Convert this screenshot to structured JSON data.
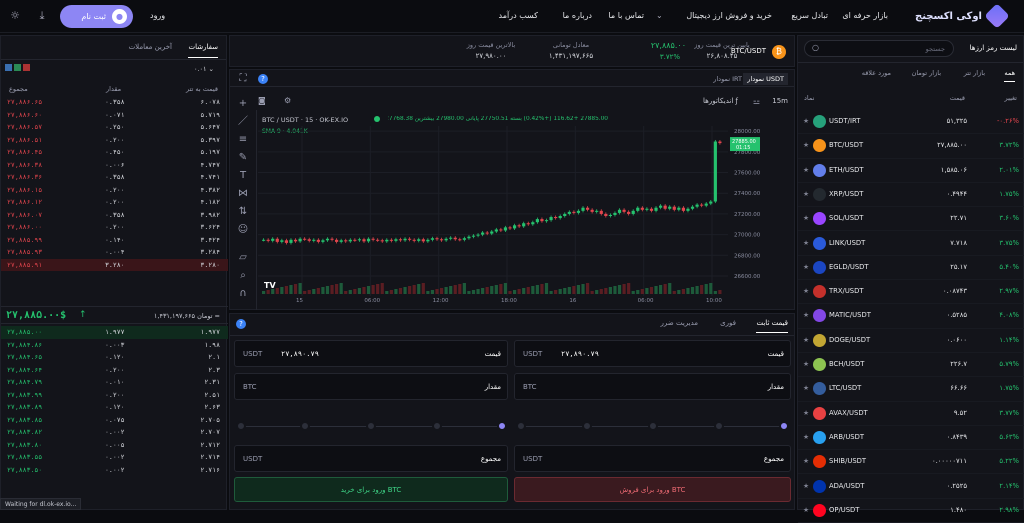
{
  "nav": {
    "brand": "اوکی اکسچنج",
    "links": [
      "بازار حرفه ای",
      "تبادل سریع",
      "خرید و فروش ارز دیجیتال",
      "تماس با ما",
      "درباره ما",
      "کسب درآمد"
    ],
    "signup": "ثبت نام",
    "login": "ورود"
  },
  "book": {
    "tabs": [
      "سفارشات",
      "آخرین معاملات"
    ],
    "precision": "۰.۰۱",
    "headers": [
      "قیمت به تتر",
      "مقدار",
      "مجموع"
    ],
    "asks": [
      [
        "۲۷,۸۸۶.۶۵",
        "۰.۳۵۸",
        "۶.۰۷۸"
      ],
      [
        "۲۷,۸۸۶.۶۰",
        "۰.۰۷۱",
        "۵.۷۱۹"
      ],
      [
        "۲۷,۸۸۶.۵۷",
        "۰.۲۵۰",
        "۵.۶۴۷"
      ],
      [
        "۲۷,۸۸۶.۵۱",
        "۰.۲۰۰",
        "۵.۳۹۷"
      ],
      [
        "۲۷,۸۸۶.۴۵",
        "۰.۴۵۰",
        "۵.۱۹۷"
      ],
      [
        "۲۷,۸۸۶.۳۸",
        "۰.۰۰۶",
        "۴.۷۴۷"
      ],
      [
        "۲۷,۸۸۶.۳۶",
        "۰.۳۵۸",
        "۴.۷۴۱"
      ],
      [
        "۲۷,۸۸۶.۱۵",
        "۰.۲۰۰",
        "۴.۳۸۲"
      ],
      [
        "۲۷,۸۸۶.۱۲",
        "۰.۲۰۰",
        "۴.۱۸۲"
      ],
      [
        "۲۷,۸۸۶.۰۷",
        "۰.۳۵۸",
        "۳.۹۸۲"
      ],
      [
        "۲۷,۸۸۶.۰۰",
        "۰.۲۰۰",
        "۳.۶۲۴"
      ],
      [
        "۲۷,۸۸۵.۹۹",
        "۰.۱۴۰",
        "۳.۴۲۴"
      ],
      [
        "۲۷,۸۸۵.۹۳",
        "۰.۰۰۴",
        "۳.۲۸۴"
      ],
      [
        "۲۷,۸۸۵.۹۱",
        "۳.۲۸۰",
        "۳.۲۸۰"
      ]
    ],
    "last_price": "۲۷,۸۸۵.۰۰$",
    "last_price_irt": "۱,۴۳۱,۱۹۷,۶۶۵ تومان =",
    "bids": [
      [
        "۲۷,۸۸۵.۰۰",
        "۱.۹۷۷",
        "۱.۹۷۷"
      ],
      [
        "۲۷,۸۸۴.۸۶",
        "۰.۰۰۳",
        "۱.۹۸"
      ],
      [
        "۲۷,۸۸۴.۶۵",
        "۰.۱۲۰",
        "۲.۱"
      ],
      [
        "۲۷,۸۸۴.۶۴",
        "۰.۲۰۰",
        "۲.۳"
      ],
      [
        "۲۷,۸۸۴.۷۹",
        "۰.۰۱۰",
        "۲.۳۱"
      ],
      [
        "۲۷,۸۸۳.۹۹",
        "۰.۲۰۰",
        "۲.۵۱"
      ],
      [
        "۲۷,۸۸۳.۸۹",
        "۰.۱۲۰",
        "۲.۶۳"
      ],
      [
        "۲۷,۸۸۳.۸۵",
        "۰.۰۷۵",
        "۲.۷۰۵"
      ],
      [
        "۲۷,۸۸۳.۸۲",
        "۰.۰۰۲",
        "۲.۷۰۷"
      ],
      [
        "۲۷,۸۸۳.۸۰",
        "۰.۰۰۵",
        "۲.۷۱۲"
      ],
      [
        "۲۷,۸۸۳.۵۵",
        "۰.۰۰۲",
        "۲.۷۱۴"
      ],
      [
        "۲۷,۸۸۳.۵۰",
        "۰.۰۰۲",
        "۲.۷۱۶"
      ]
    ]
  },
  "header": {
    "pair": "BTC/USDT",
    "price": "۲۷,۸۸۵.۰۰",
    "change": "۳.۷۲%",
    "stats": [
      {
        "label": "پایین ترین قیمت روز",
        "value": "۲۶,۸۰۸.۴۵"
      },
      {
        "label": "بالاترین قیمت روز",
        "value": "۲۷,۹۸۰.۰۰"
      },
      {
        "label": "معادل تومانی",
        "value": "۱,۴۳۱,۱۹۷,۶۶۵"
      }
    ]
  },
  "chart": {
    "tabs": [
      "نمودار USDT",
      "نمودار IRT"
    ],
    "interval": "15m",
    "indicators_label": "اندیکاتورها",
    "legend": "BTC / USDT · 15 · OK-EX.IO",
    "ohlc": "27885.00 +116.62 (+0.42%) بسته 27750.51 پایانی 27980.00 بیشترین 27768.38 باز",
    "sma": "SMA 9 · 4.041K",
    "price_tag": "27885.00",
    "price_tag_time": "01:15",
    "y_ticks": [
      "28000.00",
      "27800.00",
      "27600.00",
      "27400.00",
      "27200.00",
      "27000.00",
      "26800.00",
      "26600.00"
    ],
    "x_ticks": [
      "15",
      "06:00",
      "12:00",
      "18:00",
      "16",
      "06:00",
      "10:00"
    ]
  },
  "chart_data": {
    "type": "candlestick",
    "ylim": [
      26600,
      28050
    ],
    "series": [
      26950,
      26940,
      26960,
      26930,
      26945,
      26920,
      26950,
      26935,
      26960,
      26955,
      26940,
      26950,
      26930,
      26945,
      26960,
      26950,
      26930,
      26945,
      26935,
      26950,
      26945,
      26955,
      26935,
      26960,
      26950,
      26945,
      26935,
      26950,
      26940,
      26955,
      26945,
      26960,
      26950,
      26940,
      26955,
      26935,
      26950,
      26965,
      26955,
      26945,
      26960,
      26970,
      26955,
      26950,
      26965,
      26980,
      26990,
      27000,
      27020,
      27010,
      27030,
      27050,
      27040,
      27070,
      27060,
      27090,
      27080,
      27110,
      27100,
      27120,
      27150,
      27130,
      27140,
      27170,
      27160,
      27180,
      27200,
      27220,
      27210,
      27230,
      27260,
      27240,
      27220,
      27230,
      27200,
      27180,
      27190,
      27210,
      27240,
      27220,
      27200,
      27230,
      27260,
      27240,
      27250,
      27230,
      27260,
      27280,
      27250,
      27270,
      27240,
      27260,
      27230,
      27250,
      27270,
      27290,
      27280,
      27300,
      27320,
      27900,
      27885
    ]
  },
  "trade": {
    "tabs": [
      "قیمت ثابت",
      "فوری",
      "مدیریت ضرر"
    ],
    "buy": {
      "price_label": "قیمت",
      "price_value": "۲۷,۸۹۰.۷۹",
      "unit": "USDT",
      "amount_label": "مقدار",
      "amount_unit": "BTC",
      "total_label": "مجموع",
      "total_unit": "USDT",
      "button": "ورود برای خرید BTC"
    },
    "sell": {
      "price_label": "قیمت",
      "price_value": "۲۷,۸۹۰.۷۹",
      "unit": "USDT",
      "amount_label": "مقدار",
      "amount_unit": "BTC",
      "total_label": "مجموع",
      "total_unit": "USDT",
      "button": "ورود برای فروش BTC"
    }
  },
  "market": {
    "title": "لیست رمز ارزها",
    "search_placeholder": "جستجو",
    "tabs": [
      "همه",
      "بازار تتر",
      "بازار تومان",
      "مورد علاقه"
    ],
    "headers": [
      "نماد",
      "قیمت",
      "تغییر"
    ],
    "rows": [
      {
        "sym": "USDT/IRT",
        "price": "۵۱,۳۲۵",
        "chg": "-۰.۲۶%",
        "up": false,
        "color": "#26a17b"
      },
      {
        "sym": "BTC/USDT",
        "price": "۲۷,۸۸۵.۰۰",
        "chg": "۳.۷۲%",
        "up": true,
        "color": "#f7931a"
      },
      {
        "sym": "ETH/USDT",
        "price": "۱,۵۸۵.۰۶",
        "chg": "۲.۰۱%",
        "up": true,
        "color": "#627eea"
      },
      {
        "sym": "XRP/USDT",
        "price": "۰.۴۹۴۴",
        "chg": "۱.۷۵%",
        "up": true,
        "color": "#23292f"
      },
      {
        "sym": "SOL/USDT",
        "price": "۲۲.۷۱",
        "chg": "۳.۶۰%",
        "up": true,
        "color": "#9945ff"
      },
      {
        "sym": "LINK/USDT",
        "price": "۷.۷۱۸",
        "chg": "۳.۷۵%",
        "up": true,
        "color": "#2a5ada"
      },
      {
        "sym": "EGLD/USDT",
        "price": "۲۵.۱۷",
        "chg": "۵.۴۰%",
        "up": true,
        "color": "#1b46c2"
      },
      {
        "sym": "TRX/USDT",
        "price": "۰.۰۸۷۴۳",
        "chg": "۲.۹۷%",
        "up": true,
        "color": "#c4302b"
      },
      {
        "sym": "MATIC/USDT",
        "price": "۰.۵۲۸۵",
        "chg": "۴.۰۸%",
        "up": true,
        "color": "#8247e5"
      },
      {
        "sym": "DOGE/USDT",
        "price": "۰.۰۶۰۰",
        "chg": "۱.۱۴%",
        "up": true,
        "color": "#c2a633"
      },
      {
        "sym": "BCH/USDT",
        "price": "۲۲۶.۷",
        "chg": "۵.۷۹%",
        "up": true,
        "color": "#8dc351"
      },
      {
        "sym": "LTC/USDT",
        "price": "۶۶.۶۶",
        "chg": "۱.۷۵%",
        "up": true,
        "color": "#345d9d"
      },
      {
        "sym": "AVAX/USDT",
        "price": "۹.۵۲",
        "chg": "۳.۷۷%",
        "up": true,
        "color": "#e84142"
      },
      {
        "sym": "ARB/USDT",
        "price": "۰.۸۴۳۹",
        "chg": "۵.۶۳%",
        "up": true,
        "color": "#28a0f0"
      },
      {
        "sym": "SHIB/USDT",
        "price": "۰.۰۰۰۰۰۷۱۱",
        "chg": "۵.۲۲%",
        "up": true,
        "color": "#e42d04"
      },
      {
        "sym": "ADA/USDT",
        "price": "۰.۲۵۲۵",
        "chg": "۲.۱۴%",
        "up": true,
        "color": "#0033ad"
      },
      {
        "sym": "OP/USDT",
        "price": "۱.۴۸۰",
        "chg": "۲.۹۸%",
        "up": true,
        "color": "#ff0420"
      }
    ]
  },
  "status": "Waiting for dl.ok-ex.io..."
}
